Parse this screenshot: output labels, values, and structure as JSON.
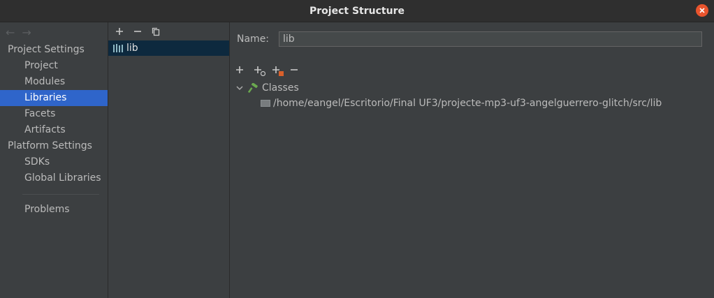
{
  "window": {
    "title": "Project Structure"
  },
  "nav": {
    "back_icon": "arrow-left-icon",
    "forward_icon": "arrow-right-icon",
    "sections": [
      {
        "header": "Project Settings",
        "items": [
          "Project",
          "Modules",
          "Libraries",
          "Facets",
          "Artifacts"
        ]
      },
      {
        "header": "Platform Settings",
        "items": [
          "SDKs",
          "Global Libraries"
        ]
      }
    ],
    "problems": "Problems",
    "selected": "Libraries"
  },
  "library_list": {
    "items": [
      {
        "label": "lib",
        "icon": "library-icon"
      }
    ]
  },
  "detail": {
    "name_label": "Name:",
    "name_value": "lib",
    "tree": {
      "root_label": "Classes",
      "children": [
        "/home/eangel/Escritorio/Final UF3/projecte-mp3-uf3-angelguerrero-glitch/src/lib"
      ]
    }
  },
  "colors": {
    "accent": "#2f65ca",
    "selected_list_bg": "#0d293e",
    "close_button": "#e9542d",
    "background": "#3c3f41"
  }
}
